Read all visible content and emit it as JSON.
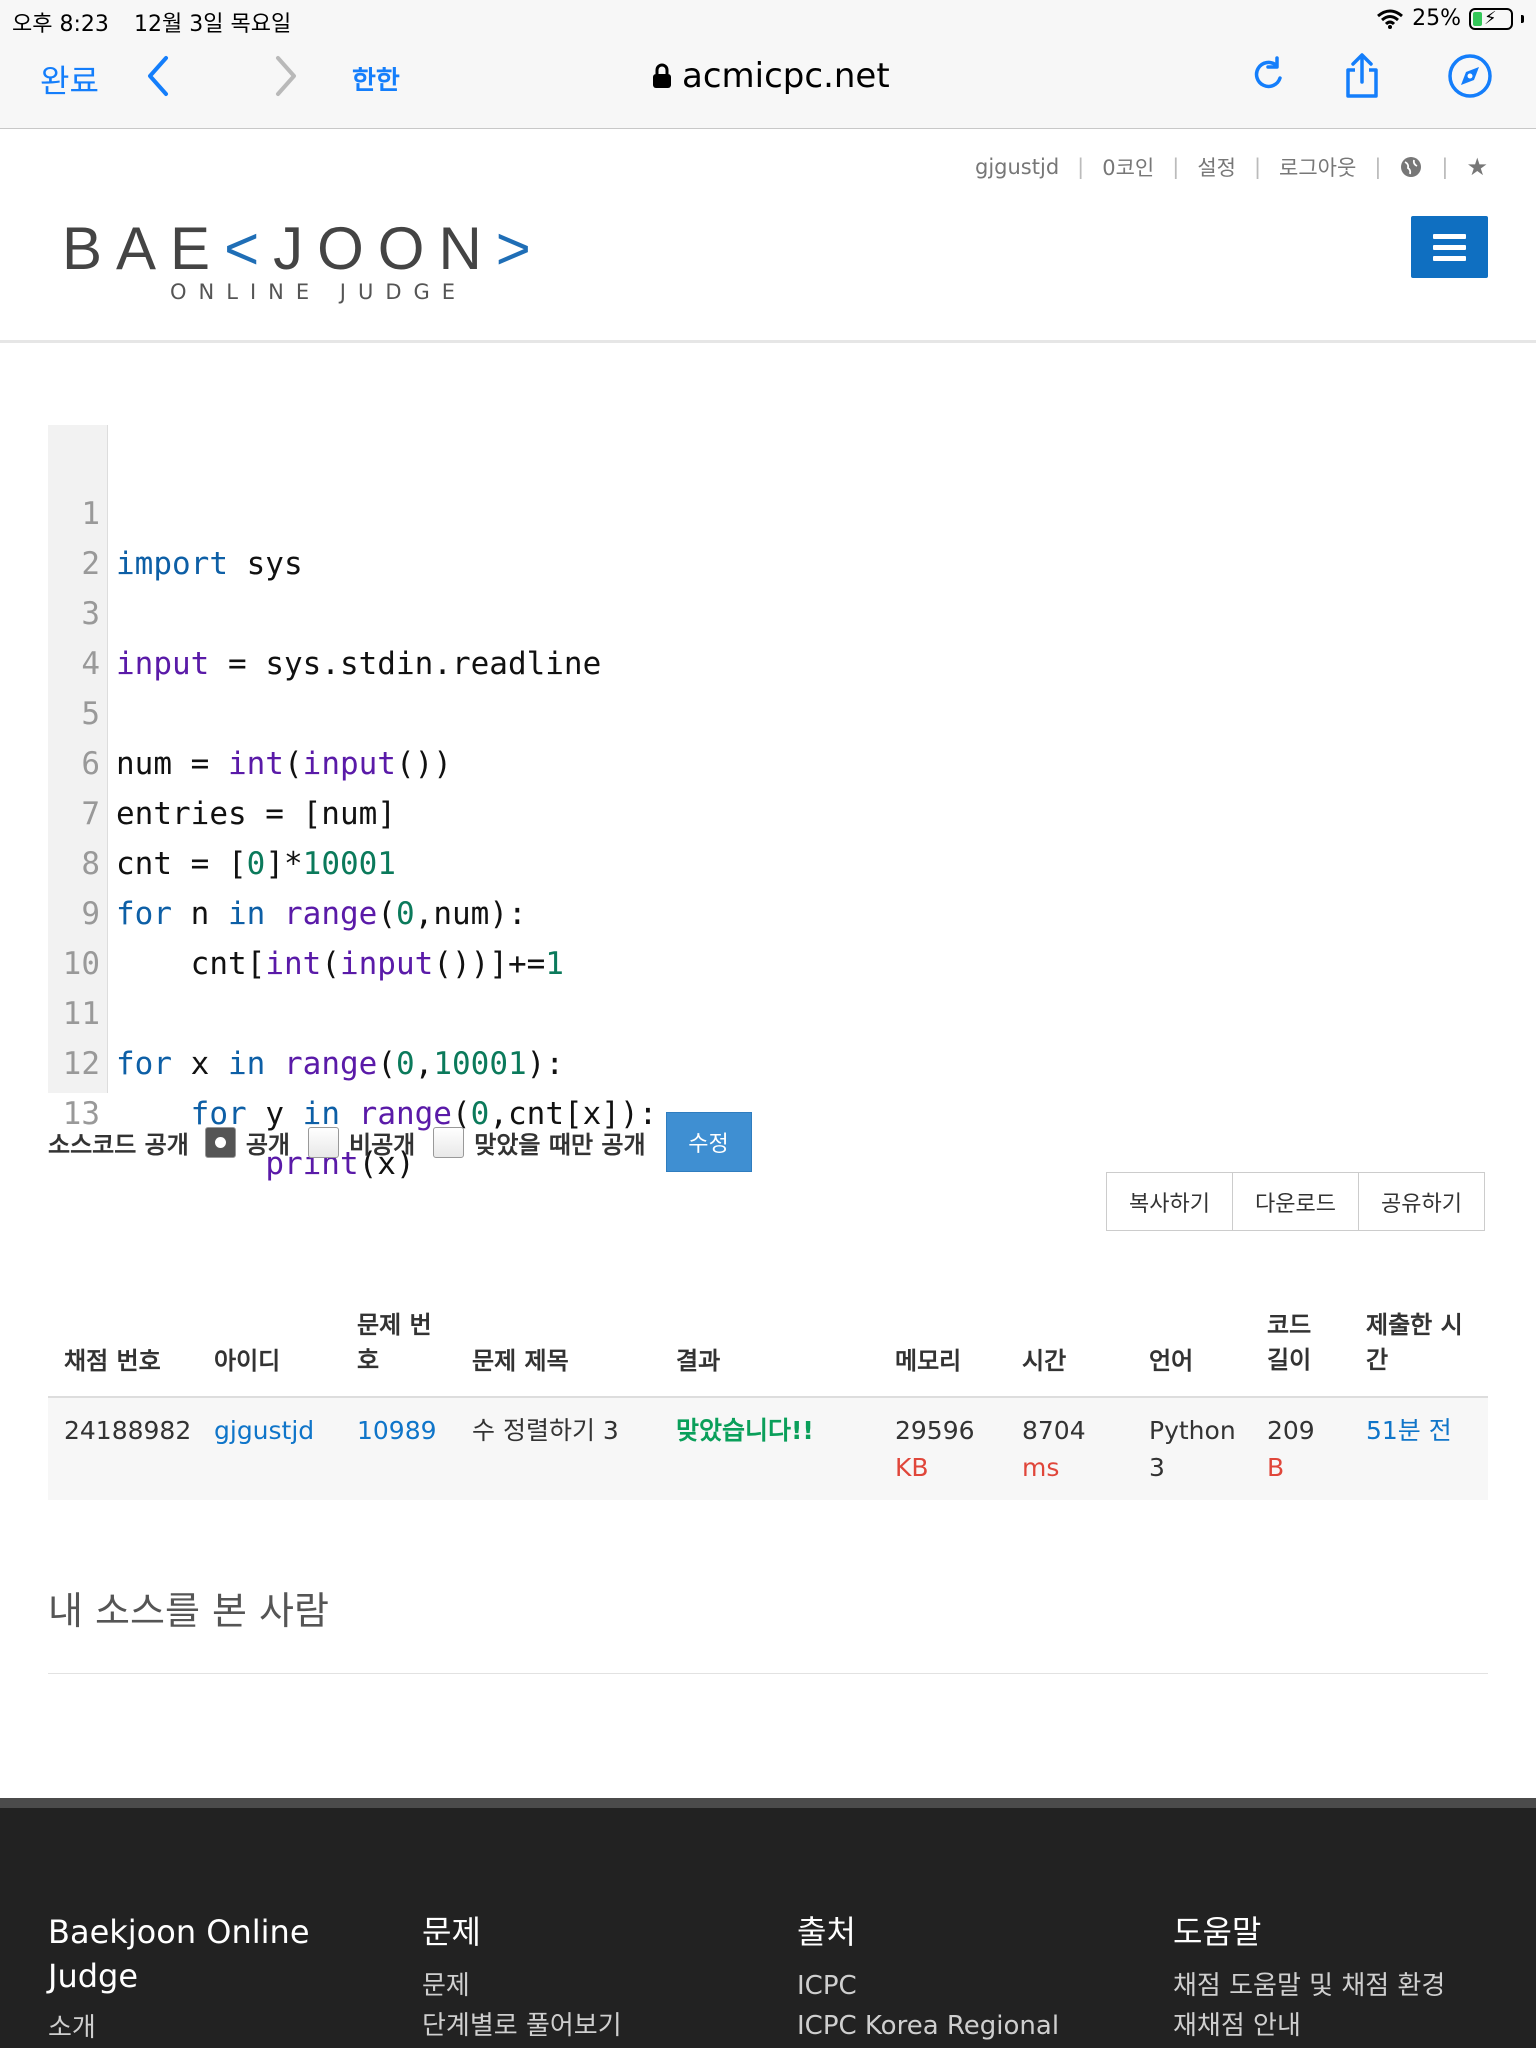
{
  "status_bar": {
    "time": "오후 8:23",
    "date": "12월 3일 목요일",
    "battery": "25%"
  },
  "browser": {
    "done": "완료",
    "text_size": "한한",
    "url": "acmicpc.net",
    "back_icon": "chevron-left-icon",
    "forward_icon": "chevron-right-icon",
    "reload_icon": "reload-icon",
    "share_icon": "share-icon",
    "compass_icon": "compass-icon"
  },
  "site": {
    "user_links": [
      "gjgustjd",
      "0코인",
      "설정",
      "로그아웃"
    ],
    "logo_main_left": "BAE",
    "logo_main_mark": "<",
    "logo_main_right": "JOON",
    "logo_main_end": ">",
    "logo_sub": "ONLINE JUDGE",
    "accent_color": "#0f6fc1"
  },
  "code": {
    "lines": [
      {
        "n": "1"
      },
      {
        "n": "2"
      },
      {
        "n": "3"
      },
      {
        "n": "4"
      },
      {
        "n": "5"
      },
      {
        "n": "6"
      },
      {
        "n": "7"
      },
      {
        "n": "8"
      },
      {
        "n": "9"
      },
      {
        "n": "10"
      },
      {
        "n": "11"
      },
      {
        "n": "12"
      },
      {
        "n": "13"
      }
    ],
    "tokens": {
      "l1": [
        "import",
        " sys"
      ],
      "l3": [
        "input",
        " = sys.stdin.readline"
      ],
      "l5": [
        "num = ",
        "int",
        "(",
        "input",
        "())"
      ],
      "l6": [
        "entries = [num]"
      ],
      "l7": [
        "cnt = [",
        "0",
        "]*",
        "10001"
      ],
      "l8": [
        "for",
        " n ",
        "in",
        " ",
        "range",
        "(",
        "0",
        ",num):"
      ],
      "l9": [
        "    cnt[",
        "int",
        "(",
        "input",
        "())]+=",
        "1"
      ],
      "l11": [
        "for",
        " x ",
        "in",
        " ",
        "range",
        "(",
        "0",
        ",",
        "10001",
        "):"
      ],
      "l12": [
        "    ",
        "for",
        " y ",
        "in",
        " ",
        "range",
        "(",
        "0",
        ",cnt[x]):"
      ],
      "l13": [
        "        ",
        "print",
        "(x)"
      ]
    }
  },
  "options": {
    "label": "소스코드 공개",
    "choices": [
      "공개",
      "비공개",
      "맞았을 때만 공개"
    ],
    "selected": "공개",
    "edit": "수정"
  },
  "actions": [
    "복사하기",
    "다운로드",
    "공유하기"
  ],
  "table": {
    "headers": [
      "채점 번호",
      "아이디",
      "문제 번\n호",
      "문제 제목",
      "결과",
      "메모리",
      "시간",
      "언어",
      "코드\n길이",
      "제출한 시\n간"
    ],
    "row": {
      "submission_id": "24188982",
      "user": "gjgustjd",
      "problem_id": "10989",
      "problem_title": "수 정렬하기 3",
      "result": "맞았습니다!!",
      "memory": "29596",
      "memory_unit": "KB",
      "time": "8704",
      "time_unit": "ms",
      "language": "Python\n3",
      "code_length": "209",
      "code_length_unit": "B",
      "submitted": "51분 전"
    }
  },
  "seen_title": "내 소스를 본 사람",
  "footer": {
    "brand": "Baekjoon Online\nJudge",
    "brand_link": "소개",
    "col2_title": "문제",
    "col2_links": [
      "문제",
      "단계별로 풀어보기"
    ],
    "col3_title": "출처",
    "col3_links": [
      "ICPC",
      "ICPC Korea Regional"
    ],
    "col4_title": "도움말",
    "col4_links": [
      "채점 도움말 및 채점 환경",
      "재채점 안내"
    ]
  }
}
